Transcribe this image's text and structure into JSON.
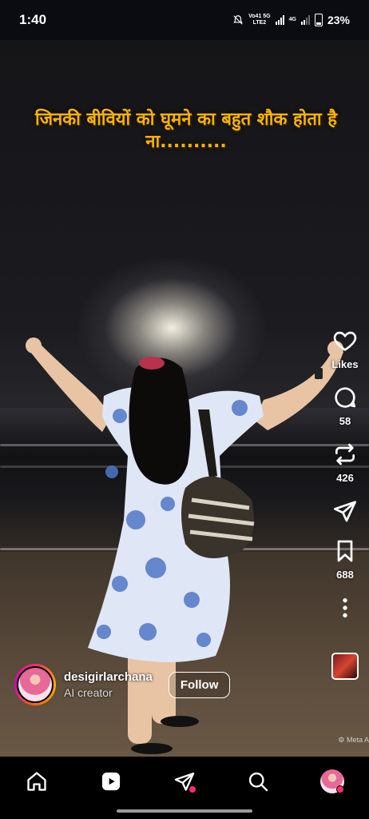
{
  "status_bar": {
    "time": "1:40",
    "network_top": "Vo41 5G",
    "network_bottom": "LTE2",
    "network2": "4G",
    "battery": "23%"
  },
  "reel": {
    "caption": "जिनकी बीवियों को घूमने का बहुत शौक होता है ना..........",
    "actions": {
      "like_label": "Likes",
      "comments": "58",
      "reposts": "426",
      "saves": "688"
    },
    "meta_ai_label": "⚙ Meta A",
    "creator": {
      "username": "desigirlarchana",
      "subtitle": "AI creator",
      "follow_label": "Follow"
    }
  },
  "nav": {
    "items": [
      "home-icon",
      "reels-icon",
      "send-icon",
      "search-icon",
      "profile-avatar"
    ]
  },
  "colors": {
    "caption": "#f5b400",
    "notification_dot": "#ff2d6f"
  }
}
